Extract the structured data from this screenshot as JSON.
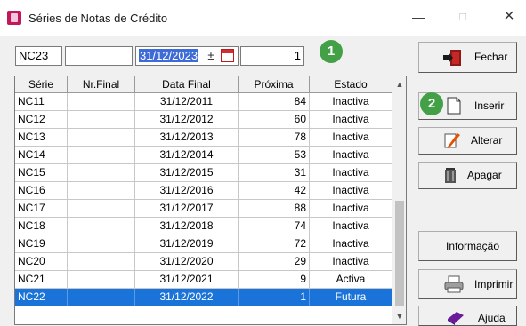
{
  "window": {
    "title": "Séries de Notas de Crédito"
  },
  "filters": {
    "serie": "NC23",
    "nr_final": "",
    "data_final": "31/12/2023",
    "proxima": "1",
    "spin_glyph": "±"
  },
  "callouts": {
    "one": "1",
    "two": "2"
  },
  "table": {
    "columns": [
      "Série",
      "Nr.Final",
      "Data Final",
      "Próxima",
      "Estado"
    ],
    "rows": [
      {
        "serie": "NC11",
        "nr_final": "",
        "data_final": "31/12/2011",
        "proxima": "84",
        "estado": "Inactiva"
      },
      {
        "serie": "NC12",
        "nr_final": "",
        "data_final": "31/12/2012",
        "proxima": "60",
        "estado": "Inactiva"
      },
      {
        "serie": "NC13",
        "nr_final": "",
        "data_final": "31/12/2013",
        "proxima": "78",
        "estado": "Inactiva"
      },
      {
        "serie": "NC14",
        "nr_final": "",
        "data_final": "31/12/2014",
        "proxima": "53",
        "estado": "Inactiva"
      },
      {
        "serie": "NC15",
        "nr_final": "",
        "data_final": "31/12/2015",
        "proxima": "31",
        "estado": "Inactiva"
      },
      {
        "serie": "NC16",
        "nr_final": "",
        "data_final": "31/12/2016",
        "proxima": "42",
        "estado": "Inactiva"
      },
      {
        "serie": "NC17",
        "nr_final": "",
        "data_final": "31/12/2017",
        "proxima": "88",
        "estado": "Inactiva"
      },
      {
        "serie": "NC18",
        "nr_final": "",
        "data_final": "31/12/2018",
        "proxima": "74",
        "estado": "Inactiva"
      },
      {
        "serie": "NC19",
        "nr_final": "",
        "data_final": "31/12/2019",
        "proxima": "72",
        "estado": "Inactiva"
      },
      {
        "serie": "NC20",
        "nr_final": "",
        "data_final": "31/12/2020",
        "proxima": "29",
        "estado": "Inactiva"
      },
      {
        "serie": "NC21",
        "nr_final": "",
        "data_final": "31/12/2021",
        "proxima": "9",
        "estado": "Activa"
      },
      {
        "serie": "NC22",
        "nr_final": "",
        "data_final": "31/12/2022",
        "proxima": "1",
        "estado": "Futura"
      }
    ],
    "selected_serie": "NC22"
  },
  "buttons": {
    "fechar": "Fechar",
    "inserir": "Inserir",
    "alterar": "Alterar",
    "apagar": "Apagar",
    "informacao": "Informação",
    "imprimir": "Imprimir",
    "ajuda": "Ajuda"
  },
  "colors": {
    "selection": "#1a73d9",
    "callout": "#43a047",
    "app_icon": "#c2185b"
  },
  "icons": {
    "app": "app-icon",
    "calendar": "calendar-icon",
    "fechar": "exit-door-icon",
    "inserir": "blank-document-icon",
    "alterar": "pencil-edit-icon",
    "apagar": "trash-can-icon",
    "imprimir": "printer-icon",
    "ajuda": "help-book-icon"
  }
}
